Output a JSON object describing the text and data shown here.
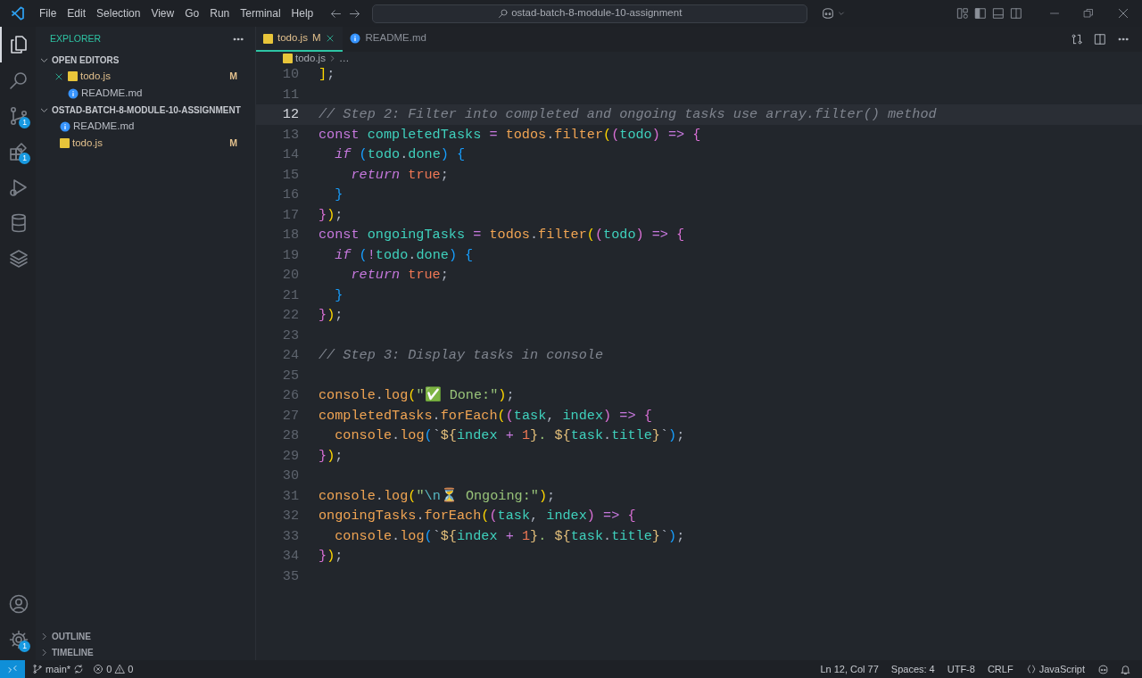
{
  "title_bar": {
    "menus": [
      "File",
      "Edit",
      "Selection",
      "View",
      "Go",
      "Run",
      "Terminal",
      "Help"
    ],
    "search": "ostad-batch-8-module-10-assignment"
  },
  "activity_bar": {
    "items": [
      {
        "kind": "explorer",
        "selected": true
      },
      {
        "kind": "search",
        "selected": false
      },
      {
        "kind": "source-control",
        "selected": false,
        "badge": "1"
      },
      {
        "kind": "extensions",
        "selected": false,
        "badge": "1"
      },
      {
        "kind": "run",
        "selected": false
      },
      {
        "kind": "database",
        "selected": false
      },
      {
        "kind": "layers",
        "selected": false
      }
    ],
    "bottom": [
      {
        "kind": "account",
        "selected": false
      },
      {
        "kind": "settings",
        "selected": false,
        "badge": "1"
      }
    ]
  },
  "sidebar": {
    "title": "EXPLORER",
    "sections": [
      {
        "label": "OPEN EDITORS",
        "expanded": true,
        "files": [
          {
            "name": "todo.js",
            "kind": "js",
            "status": "M",
            "closable": true
          },
          {
            "name": "README.md",
            "kind": "md",
            "closable": false
          }
        ]
      },
      {
        "label": "OSTAD-BATCH-8-MODULE-10-ASSIGNMENT",
        "expanded": true,
        "files": [
          {
            "name": "README.md",
            "kind": "md"
          },
          {
            "name": "todo.js",
            "kind": "js",
            "status": "M"
          }
        ]
      }
    ],
    "bottom_sections": [
      {
        "label": "OUTLINE",
        "expanded": false
      },
      {
        "label": "TIMELINE",
        "expanded": false
      }
    ]
  },
  "tabs": [
    {
      "label": "todo.js",
      "kind": "js",
      "status": "M",
      "selected": true
    },
    {
      "label": "README.md",
      "kind": "md",
      "selected": false
    }
  ],
  "breadcrumb": [
    {
      "label": "todo.js",
      "kind": "js"
    },
    {
      "label": "…"
    }
  ],
  "editor": {
    "lines": [
      {
        "number": "10",
        "active": false,
        "tokens": [
          {
            "kind": "b1",
            "text": "]"
          },
          {
            "kind": "p",
            "text": ";"
          }
        ]
      },
      {
        "number": "11",
        "active": false
      },
      {
        "number": "12",
        "active": true,
        "tokens": [
          {
            "kind": "cmt",
            "text": "// Step 2: Filter into completed and ongoing tasks use array.filter() method"
          }
        ]
      },
      {
        "number": "13",
        "active": false,
        "tokens": [
          {
            "kind": "kw",
            "text": "const "
          },
          {
            "kind": "var",
            "text": "completedTasks"
          },
          {
            "kind": "op",
            "text": " = "
          },
          {
            "kind": "obj",
            "text": "todos"
          },
          {
            "kind": "p",
            "text": "."
          },
          {
            "kind": "fn",
            "text": "filter"
          },
          {
            "kind": "b1",
            "text": "("
          },
          {
            "kind": "b2",
            "text": "("
          },
          {
            "kind": "var",
            "text": "todo"
          },
          {
            "kind": "b2",
            "text": ")"
          },
          {
            "kind": "op",
            "text": " => "
          },
          {
            "kind": "b2",
            "text": "{"
          }
        ]
      },
      {
        "number": "14",
        "active": false,
        "tokens": [
          {
            "kind": "ctl",
            "text": "  if "
          },
          {
            "kind": "b3",
            "text": "("
          },
          {
            "kind": "var",
            "text": "todo"
          },
          {
            "kind": "p",
            "text": "."
          },
          {
            "kind": "var",
            "text": "done"
          },
          {
            "kind": "b3",
            "text": ") {"
          }
        ]
      },
      {
        "number": "15",
        "active": false,
        "tokens": [
          {
            "kind": "ctl",
            "text": "    return "
          },
          {
            "kind": "bool",
            "text": "true"
          },
          {
            "kind": "p",
            "text": ";"
          }
        ]
      },
      {
        "number": "16",
        "active": false,
        "tokens": [
          {
            "kind": "b3",
            "text": "  }"
          }
        ]
      },
      {
        "number": "17",
        "active": false,
        "tokens": [
          {
            "kind": "b2",
            "text": "}"
          },
          {
            "kind": "b1",
            "text": ")"
          },
          {
            "kind": "p",
            "text": ";"
          }
        ]
      },
      {
        "number": "18",
        "active": false,
        "tokens": [
          {
            "kind": "kw",
            "text": "const "
          },
          {
            "kind": "var",
            "text": "ongoingTasks"
          },
          {
            "kind": "op",
            "text": " = "
          },
          {
            "kind": "obj",
            "text": "todos"
          },
          {
            "kind": "p",
            "text": "."
          },
          {
            "kind": "fn",
            "text": "filter"
          },
          {
            "kind": "b1",
            "text": "("
          },
          {
            "kind": "b2",
            "text": "("
          },
          {
            "kind": "var",
            "text": "todo"
          },
          {
            "kind": "b2",
            "text": ")"
          },
          {
            "kind": "op",
            "text": " => "
          },
          {
            "kind": "b2",
            "text": "{"
          }
        ]
      },
      {
        "number": "19",
        "active": false,
        "tokens": [
          {
            "kind": "ctl",
            "text": "  if "
          },
          {
            "kind": "b3",
            "text": "("
          },
          {
            "kind": "op",
            "text": "!"
          },
          {
            "kind": "var",
            "text": "todo"
          },
          {
            "kind": "p",
            "text": "."
          },
          {
            "kind": "var",
            "text": "done"
          },
          {
            "kind": "b3",
            "text": ") {"
          }
        ]
      },
      {
        "number": "20",
        "active": false,
        "tokens": [
          {
            "kind": "ctl",
            "text": "    return "
          },
          {
            "kind": "bool",
            "text": "true"
          },
          {
            "kind": "p",
            "text": ";"
          }
        ]
      },
      {
        "number": "21",
        "active": false,
        "tokens": [
          {
            "kind": "b3",
            "text": "  }"
          }
        ]
      },
      {
        "number": "22",
        "active": false,
        "tokens": [
          {
            "kind": "b2",
            "text": "}"
          },
          {
            "kind": "b1",
            "text": ")"
          },
          {
            "kind": "p",
            "text": ";"
          }
        ]
      },
      {
        "number": "23",
        "active": false
      },
      {
        "number": "24",
        "active": false,
        "tokens": [
          {
            "kind": "cmt",
            "text": "// Step 3: Display tasks in console"
          }
        ]
      },
      {
        "number": "25",
        "active": false
      },
      {
        "number": "26",
        "active": false,
        "tokens": [
          {
            "kind": "obj",
            "text": "console"
          },
          {
            "kind": "p",
            "text": "."
          },
          {
            "kind": "fn",
            "text": "log"
          },
          {
            "kind": "b1",
            "text": "("
          },
          {
            "kind": "str",
            "text": "\"✅ Done:\""
          },
          {
            "kind": "b1",
            "text": ")"
          },
          {
            "kind": "p",
            "text": ";"
          }
        ]
      },
      {
        "number": "27",
        "active": false,
        "tokens": [
          {
            "kind": "obj",
            "text": "completedTasks"
          },
          {
            "kind": "p",
            "text": "."
          },
          {
            "kind": "fn",
            "text": "forEach"
          },
          {
            "kind": "b1",
            "text": "("
          },
          {
            "kind": "b2",
            "text": "("
          },
          {
            "kind": "var",
            "text": "task"
          },
          {
            "kind": "p",
            "text": ", "
          },
          {
            "kind": "var",
            "text": "index"
          },
          {
            "kind": "b2",
            "text": ")"
          },
          {
            "kind": "op",
            "text": " => "
          },
          {
            "kind": "b2",
            "text": "{"
          }
        ]
      },
      {
        "number": "28",
        "active": false,
        "tokens": [
          {
            "kind": "obj",
            "text": "  console"
          },
          {
            "kind": "p",
            "text": "."
          },
          {
            "kind": "fn",
            "text": "log"
          },
          {
            "kind": "b3",
            "text": "("
          },
          {
            "kind": "p",
            "text": "`"
          },
          {
            "kind": "tpl",
            "text": "${"
          },
          {
            "kind": "var",
            "text": "index"
          },
          {
            "kind": "op",
            "text": " + "
          },
          {
            "kind": "num",
            "text": "1"
          },
          {
            "kind": "tpl",
            "text": "}"
          },
          {
            "kind": "str",
            "text": ". "
          },
          {
            "kind": "tpl",
            "text": "${"
          },
          {
            "kind": "var",
            "text": "task"
          },
          {
            "kind": "p",
            "text": "."
          },
          {
            "kind": "var",
            "text": "title"
          },
          {
            "kind": "tpl",
            "text": "}"
          },
          {
            "kind": "p",
            "text": "`"
          },
          {
            "kind": "b3",
            "text": ")"
          },
          {
            "kind": "p",
            "text": ";"
          }
        ]
      },
      {
        "number": "29",
        "active": false,
        "tokens": [
          {
            "kind": "b2",
            "text": "}"
          },
          {
            "kind": "b1",
            "text": ")"
          },
          {
            "kind": "p",
            "text": ";"
          }
        ]
      },
      {
        "number": "30",
        "active": false
      },
      {
        "number": "31",
        "active": false,
        "tokens": [
          {
            "kind": "obj",
            "text": "console"
          },
          {
            "kind": "p",
            "text": "."
          },
          {
            "kind": "fn",
            "text": "log"
          },
          {
            "kind": "b1",
            "text": "("
          },
          {
            "kind": "str",
            "text": "\""
          },
          {
            "kind": "esc",
            "text": "\\n"
          },
          {
            "kind": "str",
            "text": "⏳ Ongoing:\""
          },
          {
            "kind": "b1",
            "text": ")"
          },
          {
            "kind": "p",
            "text": ";"
          }
        ]
      },
      {
        "number": "32",
        "active": false,
        "tokens": [
          {
            "kind": "obj",
            "text": "ongoingTasks"
          },
          {
            "kind": "p",
            "text": "."
          },
          {
            "kind": "fn",
            "text": "forEach"
          },
          {
            "kind": "b1",
            "text": "("
          },
          {
            "kind": "b2",
            "text": "("
          },
          {
            "kind": "var",
            "text": "task"
          },
          {
            "kind": "p",
            "text": ", "
          },
          {
            "kind": "var",
            "text": "index"
          },
          {
            "kind": "b2",
            "text": ")"
          },
          {
            "kind": "op",
            "text": " => "
          },
          {
            "kind": "b2",
            "text": "{"
          }
        ]
      },
      {
        "number": "33",
        "active": false,
        "tokens": [
          {
            "kind": "obj",
            "text": "  console"
          },
          {
            "kind": "p",
            "text": "."
          },
          {
            "kind": "fn",
            "text": "log"
          },
          {
            "kind": "b3",
            "text": "("
          },
          {
            "kind": "p",
            "text": "`"
          },
          {
            "kind": "tpl",
            "text": "${"
          },
          {
            "kind": "var",
            "text": "index"
          },
          {
            "kind": "op",
            "text": " + "
          },
          {
            "kind": "num",
            "text": "1"
          },
          {
            "kind": "tpl",
            "text": "}"
          },
          {
            "kind": "str",
            "text": ". "
          },
          {
            "kind": "tpl",
            "text": "${"
          },
          {
            "kind": "var",
            "text": "task"
          },
          {
            "kind": "p",
            "text": "."
          },
          {
            "kind": "var",
            "text": "title"
          },
          {
            "kind": "tpl",
            "text": "}"
          },
          {
            "kind": "p",
            "text": "`"
          },
          {
            "kind": "b3",
            "text": ")"
          },
          {
            "kind": "p",
            "text": ";"
          }
        ]
      },
      {
        "number": "34",
        "active": false,
        "tokens": [
          {
            "kind": "b2",
            "text": "}"
          },
          {
            "kind": "b1",
            "text": ")"
          },
          {
            "kind": "p",
            "text": ";"
          }
        ]
      },
      {
        "number": "35",
        "active": false
      }
    ]
  },
  "status_bar": {
    "branch": "main*",
    "errors": "0",
    "warnings": "0",
    "position": "Ln 12, Col 77",
    "indent": "Spaces: 4",
    "encoding": "UTF-8",
    "eol": "CRLF",
    "language": "JavaScript"
  }
}
